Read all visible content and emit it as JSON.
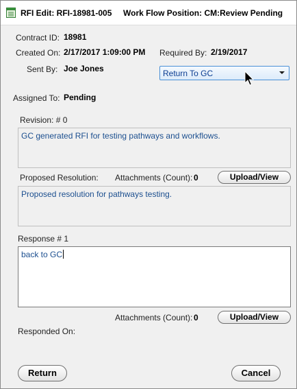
{
  "titlebar": {
    "rfi_title": "RFI Edit: RFI-18981-005",
    "workflow_title": "Work Flow Position: CM:Review Pending"
  },
  "header": {
    "contract_id_label": "Contract ID:",
    "contract_id_value": "18981",
    "created_on_label": "Created On:",
    "created_on_value": "2/17/2017 1:09:00 PM",
    "required_by_label": "Required By:",
    "required_by_value": "2/19/2017",
    "sent_by_label": "Sent By:",
    "sent_by_value": "Joe Jones",
    "action_select_value": "Return To GC",
    "assigned_to_label": "Assigned To:",
    "assigned_to_value": "Pending"
  },
  "revision": {
    "label": "Revision: # 0",
    "text": "GC generated RFI for testing pathways and workflows."
  },
  "proposed": {
    "label": "Proposed Resolution:",
    "attachments_label": "Attachments (Count):",
    "attachments_count": "0",
    "upload_label": "Upload/View",
    "text": "Proposed resolution for pathways testing."
  },
  "response": {
    "label": "Response # 1",
    "text": "back to GC",
    "attachments_label": "Attachments (Count):",
    "attachments_count": "0",
    "upload_label": "Upload/View",
    "responded_on_label": "Responded On:"
  },
  "footer": {
    "return_label": "Return",
    "cancel_label": "Cancel"
  },
  "colors": {
    "accent": "#4a8fd6",
    "text_blue": "#1c4f8f"
  }
}
